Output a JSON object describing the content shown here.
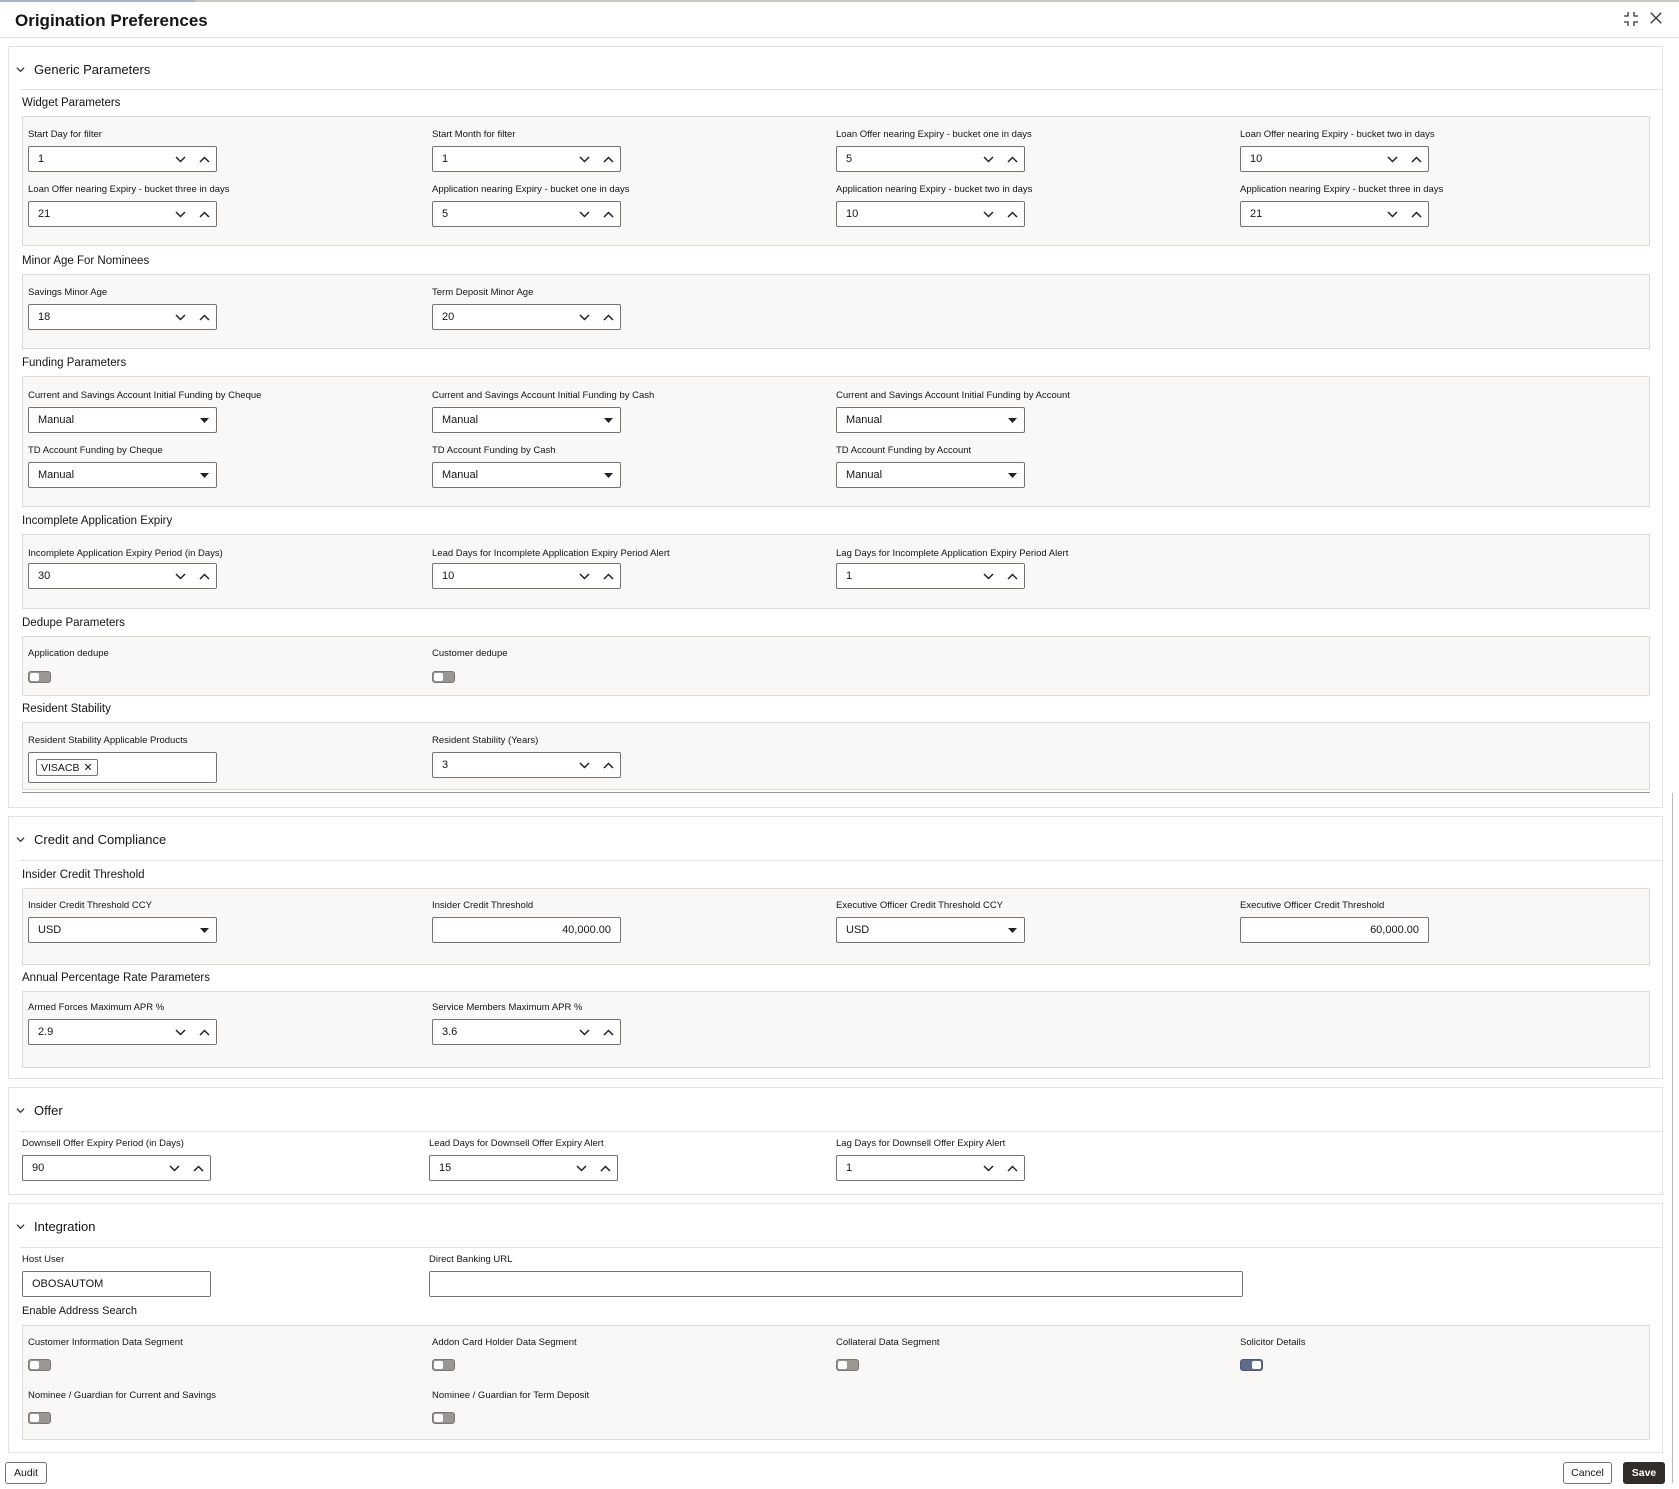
{
  "window": {
    "title": "Origination Preferences"
  },
  "sections": {
    "generic": {
      "title": "Generic Parameters",
      "widget": {
        "title": "Widget Parameters",
        "fields": [
          {
            "label": "Start Day for filter",
            "value": "1"
          },
          {
            "label": "Start Month for filter",
            "value": "1"
          },
          {
            "label": "Loan Offer nearing Expiry - bucket one in days",
            "value": "5"
          },
          {
            "label": "Loan Offer nearing Expiry - bucket two in days",
            "value": "10"
          },
          {
            "label": "Loan Offer nearing Expiry - bucket three in days",
            "value": "21"
          },
          {
            "label": "Application nearing Expiry - bucket one in days",
            "value": "5"
          },
          {
            "label": "Application nearing Expiry - bucket two in days",
            "value": "10"
          },
          {
            "label": "Application nearing Expiry - bucket three in days",
            "value": "21"
          }
        ]
      },
      "minor_age": {
        "title": "Minor Age For Nominees",
        "fields": [
          {
            "label": "Savings Minor Age",
            "value": "18"
          },
          {
            "label": "Term Deposit Minor Age",
            "value": "20"
          }
        ]
      },
      "funding": {
        "title": "Funding Parameters",
        "fields": [
          {
            "label": "Current and Savings Account Initial Funding by Cheque",
            "value": "Manual"
          },
          {
            "label": "Current and Savings Account Initial Funding by Cash",
            "value": "Manual"
          },
          {
            "label": "Current and Savings Account Initial Funding by Account",
            "value": "Manual"
          },
          {
            "label": "TD Account Funding by Cheque",
            "value": "Manual"
          },
          {
            "label": "TD Account Funding by Cash",
            "value": "Manual"
          },
          {
            "label": "TD Account Funding by Account",
            "value": "Manual"
          }
        ]
      },
      "incomplete": {
        "title": "Incomplete Application Expiry",
        "fields": [
          {
            "label": "Incomplete Application Expiry Period (in Days)",
            "value": "30"
          },
          {
            "label": "Lead Days for Incomplete Application Expiry Period Alert",
            "value": "10"
          },
          {
            "label": "Lag Days for Incomplete Application Expiry Period Alert",
            "value": "1"
          }
        ]
      },
      "dedupe": {
        "title": "Dedupe Parameters",
        "fields": [
          {
            "label": "Application dedupe",
            "on": false
          },
          {
            "label": "Customer dedupe",
            "on": false
          }
        ]
      },
      "resident": {
        "title": "Resident Stability",
        "products_label": "Resident Stability Applicable Products",
        "products": [
          "VISACB"
        ],
        "years_label": "Resident Stability (Years)",
        "years_value": "3"
      }
    },
    "credit": {
      "title": "Credit and Compliance",
      "insider": {
        "title": "Insider Credit Threshold",
        "fields": [
          {
            "label": "Insider Credit Threshold CCY",
            "value": "USD"
          },
          {
            "label": "Insider Credit Threshold",
            "value": "40,000.00"
          },
          {
            "label": "Executive Officer Credit Threshold CCY",
            "value": "USD"
          },
          {
            "label": "Executive Officer Credit Threshold",
            "value": "60,000.00"
          }
        ]
      },
      "apr": {
        "title": "Annual Percentage Rate Parameters",
        "fields": [
          {
            "label": "Armed Forces Maximum APR %",
            "value": "2.9"
          },
          {
            "label": "Service Members Maximum APR %",
            "value": "3.6"
          }
        ]
      }
    },
    "offer": {
      "title": "Offer",
      "fields": [
        {
          "label": "Downsell Offer Expiry Period (in Days)",
          "value": "90"
        },
        {
          "label": "Lead Days for Downsell Offer Expiry Alert",
          "value": "15"
        },
        {
          "label": "Lag Days for Downsell Offer Expiry Alert",
          "value": "1"
        }
      ]
    },
    "integration": {
      "title": "Integration",
      "host_user_label": "Host User",
      "host_user_value": "OBOSAUTOM",
      "direct_banking_label": "Direct Banking URL",
      "direct_banking_value": "",
      "address_search": {
        "title": "Enable Address Search",
        "fields": [
          {
            "label": "Customer Information Data Segment",
            "on": false
          },
          {
            "label": "Addon Card Holder Data Segment",
            "on": false
          },
          {
            "label": "Collateral Data Segment",
            "on": false
          },
          {
            "label": "Solicitor Details",
            "on": true
          },
          {
            "label": "Nominee / Guardian for Current and Savings",
            "on": false
          },
          {
            "label": "Nominee / Guardian for Term Deposit",
            "on": false
          }
        ]
      }
    }
  },
  "footer": {
    "audit": "Audit",
    "cancel": "Cancel",
    "save": "Save"
  }
}
